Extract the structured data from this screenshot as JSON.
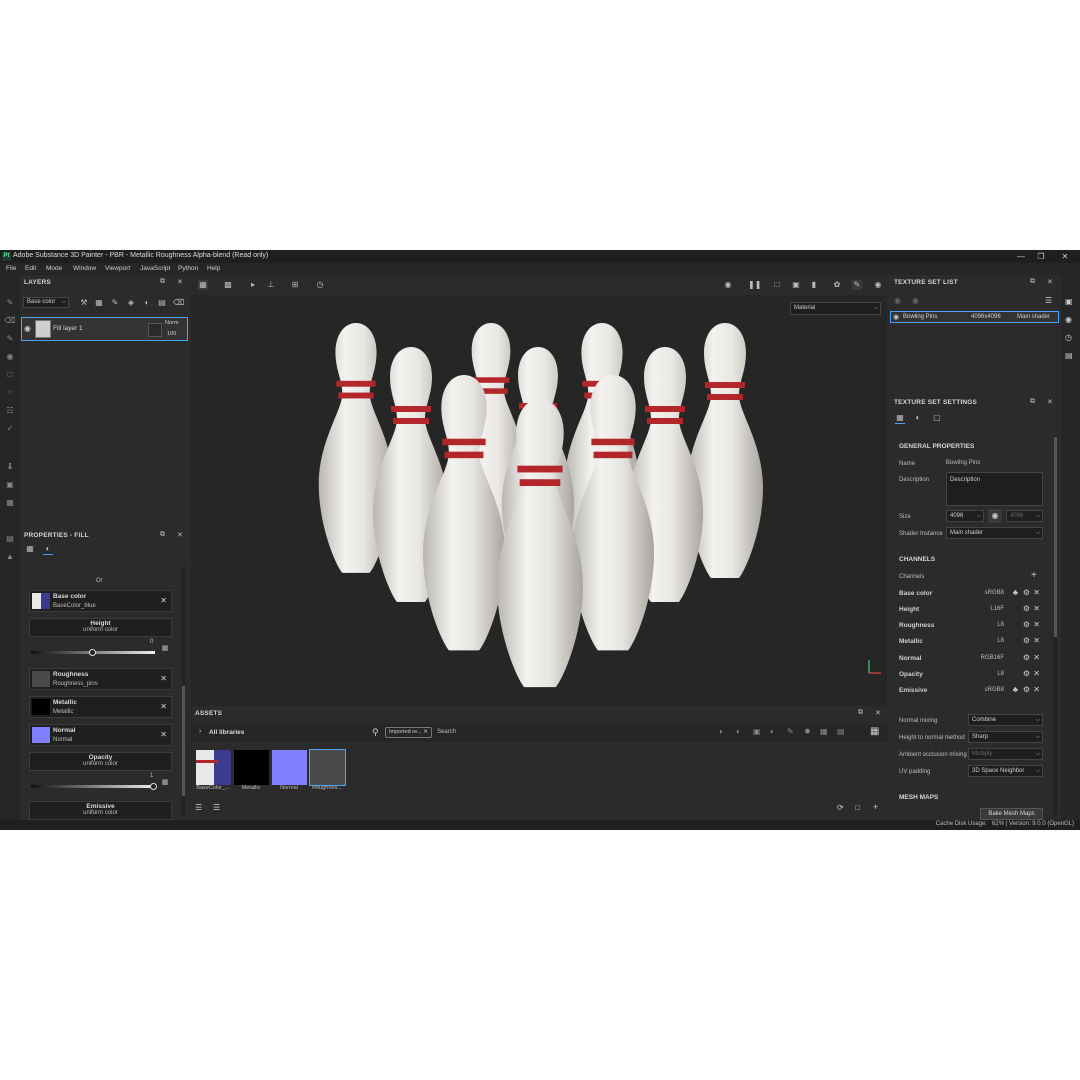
{
  "window": {
    "title": "Adobe Substance 3D Painter - PBR - Metallic Roughness Alpha-blend (Read only)",
    "logo": "Pt"
  },
  "menu": [
    "File",
    "Edit",
    "Mode",
    "Window",
    "Viewport",
    "JavaScript",
    "Python",
    "Help"
  ],
  "layers": {
    "title": "LAYERS",
    "channel_dropdown": "Base color",
    "items": [
      {
        "name": "Fill layer 1",
        "blend": "Norm",
        "opacity": "100"
      }
    ]
  },
  "properties": {
    "title": "PROPERTIES - FILL",
    "or_label": "Or",
    "slots": [
      {
        "name": "Base color",
        "source": "BaseColor_blue",
        "color": "#4a4aa8"
      },
      {
        "name": "Height",
        "source": "uniform color",
        "value": "0",
        "value_fraction": 0.5
      },
      {
        "name": "Roughness",
        "source": "Roughness_pins",
        "color": "#4a4a4a"
      },
      {
        "name": "Metallic",
        "source": "Metallic",
        "color": "#000000"
      },
      {
        "name": "Normal",
        "source": "Normal",
        "color": "#7f7fff"
      },
      {
        "name": "Opacity",
        "source": "uniform color",
        "value": "1",
        "value_fraction": 1.0
      },
      {
        "name": "Emissive",
        "source": "uniform color"
      }
    ]
  },
  "viewport": {
    "mode_dropdown": "Material"
  },
  "assets": {
    "title": "ASSETS",
    "library": "All libraries",
    "filter_tag": "Imported re...",
    "search_placeholder": "Search",
    "thumbnails": [
      {
        "label": "BaseColor_...",
        "color": "#3b3b8f"
      },
      {
        "label": "Metallic",
        "color": "#000000"
      },
      {
        "label": "Normal",
        "color": "#7f7fff"
      },
      {
        "label": "Roughnes...",
        "color": "#4a4a4a"
      }
    ]
  },
  "texture_set_list": {
    "title": "TEXTURE SET LIST",
    "items": [
      {
        "name": "Bowling Pins",
        "resolution": "4096x4096",
        "shader": "Main shader"
      }
    ]
  },
  "texture_set_settings": {
    "title": "TEXTURE SET SETTINGS",
    "general_title": "GENERAL PROPERTIES",
    "name_label": "Name",
    "name_value": "Bowling Pins",
    "description_label": "Description",
    "description_value": "Description",
    "size_label": "Size",
    "size_value": "4096",
    "size_value_locked": "4096",
    "shader_label": "Shader Instance",
    "shader_value": "Main shader",
    "channels_title": "CHANNELS",
    "channels_label": "Channels",
    "channels": [
      {
        "name": "Base color",
        "format": "sRGB8"
      },
      {
        "name": "Height",
        "format": "L16F"
      },
      {
        "name": "Roughness",
        "format": "L8"
      },
      {
        "name": "Metallic",
        "format": "L8"
      },
      {
        "name": "Normal",
        "format": "RGB16F"
      },
      {
        "name": "Opacity",
        "format": "L8"
      },
      {
        "name": "Emissive",
        "format": "sRGB8"
      }
    ],
    "normal_mixing_label": "Normal mixing",
    "normal_mixing_value": "Combine",
    "height_to_normal_label": "Height to normal method",
    "height_to_normal_value": "Sharp",
    "ao_mixing_label": "Ambient occlusion mixing",
    "ao_mixing_value": "Multiply",
    "uv_padding_label": "UV padding",
    "uv_padding_value": "3D Space Neighbor",
    "mesh_maps_title": "MESH MAPS",
    "bake_button": "Bake Mesh Maps"
  },
  "status": {
    "text": "Cache Disk Usage:   62% | Version: 9.0.0 (OpenGL)"
  },
  "colors": {
    "accent": "#4aa3ff",
    "panel_bg": "#2b2b2b",
    "pin_stripe": "#b3262a"
  }
}
